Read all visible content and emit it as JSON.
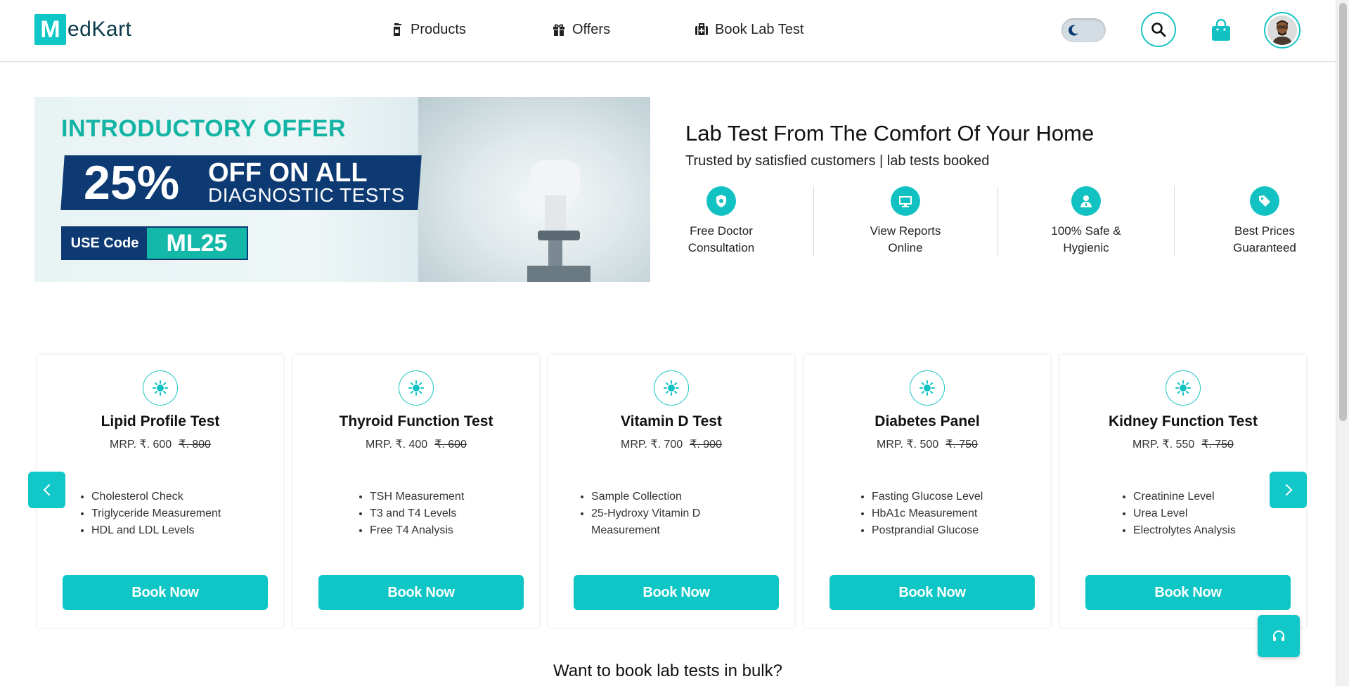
{
  "brand": {
    "logo_letter": "M",
    "logo_rest": "edKart"
  },
  "nav": [
    {
      "label": "Products",
      "icon": "bottle-icon"
    },
    {
      "label": "Offers",
      "icon": "gift-icon"
    },
    {
      "label": "Book Lab Test",
      "icon": "medical-kit-icon"
    }
  ],
  "banner": {
    "intro": "INTRODUCTORY OFFER",
    "percent": "25%",
    "off_line": "OFF ON ALL",
    "diag_line": "DIAGNOSTIC TESTS",
    "code_label": "USE Code",
    "code": "ML25"
  },
  "hero": {
    "title": "Lab Test From The Comfort Of Your Home",
    "subtitle": "Trusted by satisfied customers | lab tests booked"
  },
  "features": [
    {
      "line1": "Free Doctor",
      "line2": "Consultation",
      "icon": "shield-icon"
    },
    {
      "line1": "View Reports",
      "line2": "Online",
      "icon": "monitor-icon"
    },
    {
      "line1": "100% Safe &",
      "line2": "Hygienic",
      "icon": "doctor-icon"
    },
    {
      "line1": "Best Prices",
      "line2": "Guaranteed",
      "icon": "tag-icon"
    }
  ],
  "tests": [
    {
      "name": "Lipid Profile Test",
      "price": "MRP. ₹. 600",
      "mrp": "₹. 800",
      "items": [
        "Cholesterol Check",
        "Triglyceride Measurement",
        "HDL and LDL Levels"
      ],
      "cta": "Book Now"
    },
    {
      "name": "Thyroid Function Test",
      "price": "MRP. ₹. 400",
      "mrp": "₹. 600",
      "items": [
        "TSH Measurement",
        "T3 and T4 Levels",
        "Free T4 Analysis"
      ],
      "cta": "Book Now"
    },
    {
      "name": "Vitamin D Test",
      "price": "MRP. ₹. 700",
      "mrp": "₹. 900",
      "items": [
        "Sample Collection",
        "25-Hydroxy Vitamin D",
        "Measurement"
      ],
      "cta": "Book Now"
    },
    {
      "name": "Diabetes Panel",
      "price": "MRP. ₹. 500",
      "mrp": "₹. 750",
      "items": [
        "Fasting Glucose Level",
        "HbA1c Measurement",
        "Postprandial Glucose"
      ],
      "cta": "Book Now"
    },
    {
      "name": "Kidney Function Test",
      "price": "MRP. ₹. 550",
      "mrp": "₹. 750",
      "items": [
        "Creatinine Level",
        "Urea Level",
        "Electrolytes Analysis"
      ],
      "cta": "Book Now"
    }
  ],
  "bulk_heading": "Want to book lab tests in bulk?",
  "colors": {
    "accent": "#0ec6c6",
    "navy": "#0d3a73",
    "banner_teal": "#14b4a4"
  }
}
